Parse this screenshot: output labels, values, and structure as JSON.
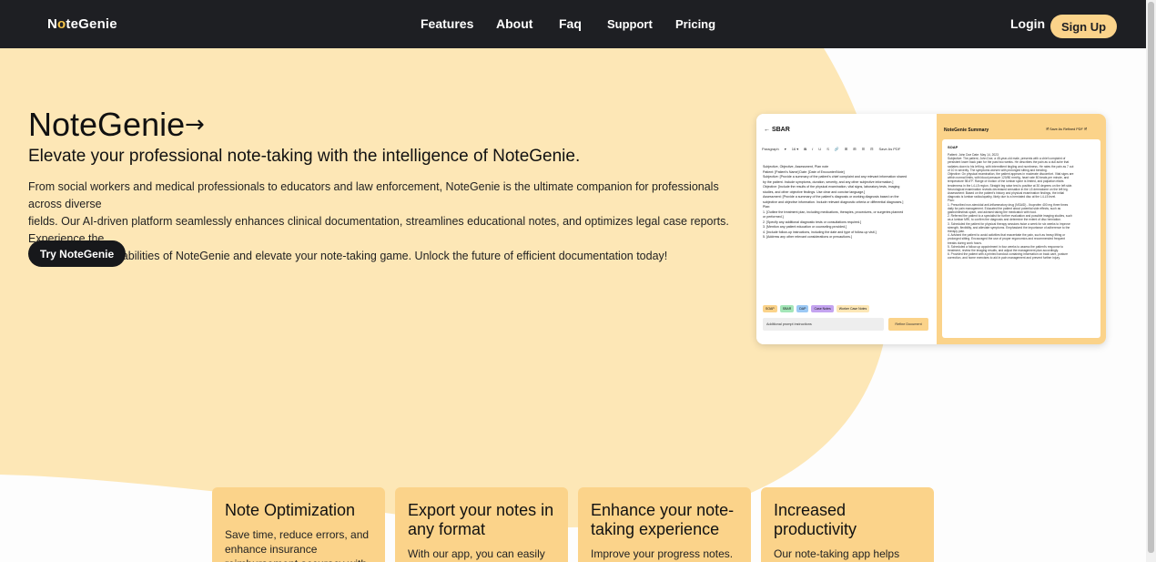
{
  "nav": {
    "logo_pre": "N",
    "logo_o": "o",
    "logo_post": "teGenie",
    "links": [
      "Features",
      "About",
      "Faq",
      "Support",
      "Pricing"
    ],
    "login": "Login",
    "signup": "Sign Up"
  },
  "hero": {
    "title": "NoteGenie",
    "arrow": "→",
    "subtitle": "Elevate your professional note-taking with the intelligence of NoteGenie.",
    "body_lines": [
      "From social workers and medical professionals to educators and law enforcement, NoteGenie is the ultimate companion for professionals across diverse",
      "fields. Our AI-driven platform seamlessly enhances clinical documentation, streamlines educational notes, and optimizes legal case reports. Experience the",
      "transformative capabilities of NoteGenie and elevate your note-taking game. Unlock the future of efficient documentation today!"
    ],
    "cta": "Try NoteGenie"
  },
  "mockup": {
    "back": "← SBAR",
    "toolbar": [
      "Paragraph",
      "▾",
      "16 ▾",
      "B",
      "I",
      "U",
      "S",
      "🔗",
      "⊞",
      "⊞",
      "☰",
      "⊟",
      "Save As PDF"
    ],
    "left_lines": [
      "Subjective, Objective, Assessment, Plan note",
      "Patient: [Patient's Name] Date: [Date of Encounter/Note]",
      "Subjective: [Provide a summary of the patient's chief complaint and any relevant information shared",
      "by the patient. Include symptoms, duration, severity, and any other subjective information.]",
      "Objective: [Include the results of the physical examination, vital signs, laboratory tests, imaging",
      "studies, and other objective findings. Use clear and concise language.]",
      "Assessment: [Provide a summary of the patient's diagnosis or working diagnosis based on the",
      "subjective and objective information. Include relevant diagnostic criteria or differential diagnoses.]",
      "Plan:",
      "  1. [Outline the treatment plan, including medications, therapies, procedures, or surgeries planned",
      "     or performed.]",
      "  2. [Specify any additional diagnostic tests or consultations required.]",
      "  3. [Mention any patient education or counseling provided.]",
      "  4. [Include follow-up instructions, including the date and type of follow-up visit.]",
      "  5. [Address any other relevant considerations or precautions.]"
    ],
    "chips": [
      "SOAP",
      "SBAR",
      "DAP",
      "Case Notes",
      "Worker Case Notes"
    ],
    "input_placeholder": "Additional prompt instructions",
    "refine": "Refine Document",
    "right_title": "NoteGenie Summary",
    "right_actions": "🗎 Save As Refined PDF   🗎",
    "doc_head": "SOAP",
    "doc_lines": [
      "Patient: John Doe Date: May 14, 2023",
      "Subjective: The patient, John Doe, a 45-year-old male, presents with a chief complaint of",
      "persistent lower back pain for the past two weeks. He describes the pain as a dull ache that",
      "radiates down to his left leg, with intermittent tingling and numbness. He rates the pain as 7 out",
      "of 10 in severity. The symptoms worsen with prolonged sitting and bending.",
      "Objective: On physical examination, the patient appears in moderate discomfort. Vital signs are",
      "within normal limits, with blood pressure 120/80 mmHg, heart rate 80 beats per minute, and",
      "temperature 98.6°F. Range of motion of the lumbar spine is limited, and palpation elicits",
      "tenderness in the L4-L5 region. Straight leg raise test is positive at 30 degrees on the left side.",
      "Neurological examination reveals decreased sensation in the L5 dermatome on the left leg.",
      "Assessment: Based on the patient's history and physical examination findings, the initial",
      "diagnosis is lumbar radiculopathy, likely due to a herniated disc at the L4-L5 level.",
      "Plan:",
      "  1. Prescribed non-steroidal anti-inflammatory drug (NSAID) - Ibuprofen 400 mg three times",
      "     daily for pain management. Educated the patient about potential side effects, such as",
      "     gastrointestinal upset, and advised taking the medication with food.",
      "  2. Referred the patient to a specialist for further evaluation and possible imaging studies, such",
      "     as a lumbar MRI, to confirm the diagnosis and determine the extent of disc herniation.",
      "  3. Scheduled the patient for physical therapy sessions twice a week for six weeks to improve",
      "     strength, flexibility, and alleviate symptoms. Emphasized the importance of adherence to the",
      "     therapy plan.",
      "  4. Advised the patient to avoid activities that exacerbate the pain, such as heavy lifting or",
      "     prolonged sitting. Encouraged the use of proper ergonomics and recommended frequent",
      "     breaks during work hours.",
      "  5. Scheduled a follow-up appointment in four weeks to assess the patient's response to",
      "     treatment, review the imaging results, and adjust the management plan accordingly.",
      "  6. Provided the patient with a printed handout containing information on back care, posture",
      "     correction, and home exercises to aid in pain management and prevent further injury."
    ]
  },
  "features": [
    {
      "title": "Note Optimization",
      "body": "Save time, reduce errors, and enhance insurance reimbursement accuracy with"
    },
    {
      "title": "Export your notes in any format",
      "body": "With our app, you can easily"
    },
    {
      "title": "Enhance your note-taking experience",
      "body": "Improve your progress notes."
    },
    {
      "title": "Increased productivity",
      "body": "Our note-taking app helps you"
    }
  ],
  "colors": {
    "nav_bg": "#1e1f23",
    "accent": "#fbd38a",
    "hero_bg": "#fde7b6",
    "dark_button": "#17181b"
  }
}
